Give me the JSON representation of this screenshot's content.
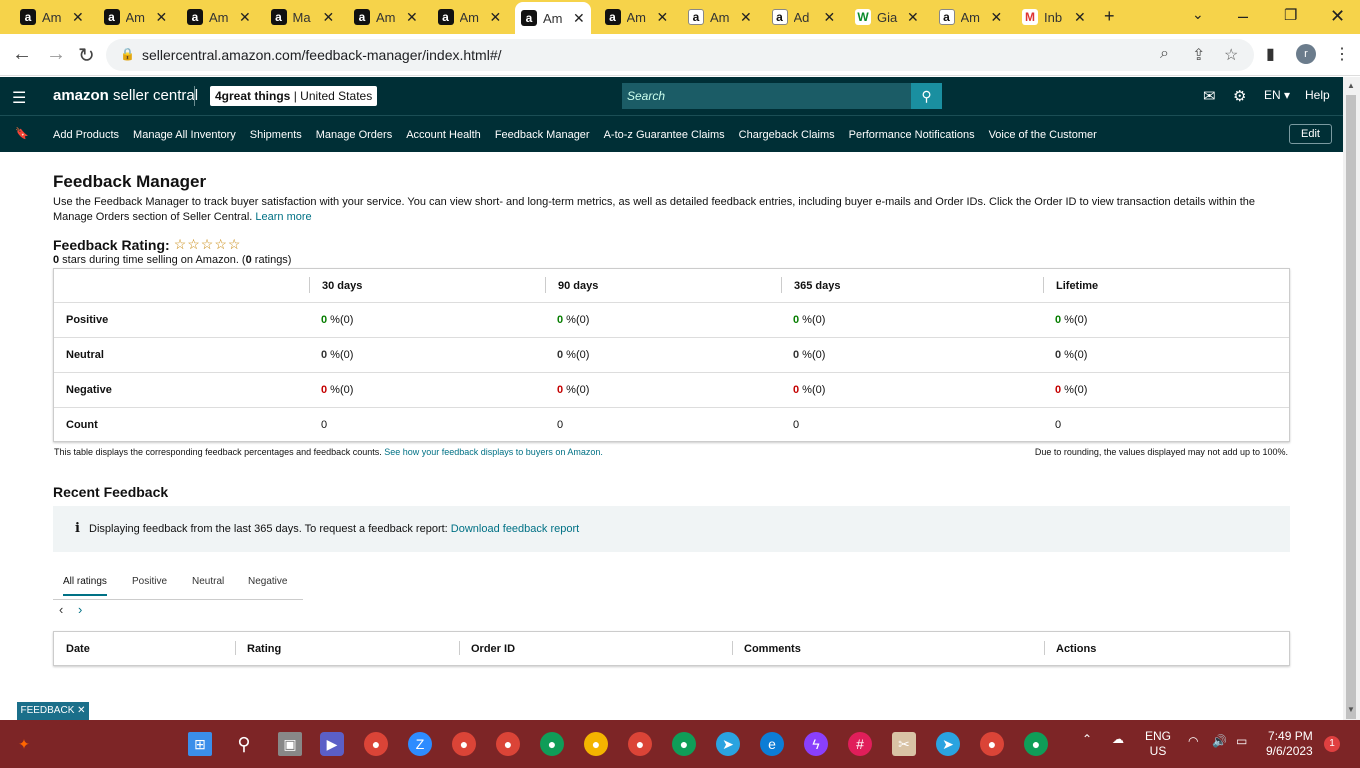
{
  "browser": {
    "tabs": [
      {
        "icon": "amazon-icon",
        "title": "Am",
        "active": false
      },
      {
        "icon": "amazon-icon",
        "title": "Am",
        "active": false
      },
      {
        "icon": "amazon-icon",
        "title": "Am",
        "active": false
      },
      {
        "icon": "amazon-icon",
        "title": "Ma",
        "active": false
      },
      {
        "icon": "amazon-icon",
        "title": "Am",
        "active": false
      },
      {
        "icon": "amazon-icon",
        "title": "Am",
        "active": false
      },
      {
        "icon": "amazon-icon",
        "title": "Am",
        "active": true
      },
      {
        "icon": "amazon-icon",
        "title": "Am",
        "active": false
      },
      {
        "icon": "amazon-icon",
        "title": "Am",
        "active": false
      },
      {
        "icon": "amazon-icon",
        "title": "Ad",
        "active": false
      },
      {
        "icon": "gia-icon",
        "title": "Gia",
        "active": false
      },
      {
        "icon": "amazon-icon",
        "title": "Am",
        "active": false
      },
      {
        "icon": "gmail-icon",
        "title": "Inb",
        "active": false
      }
    ],
    "url": "sellercentral.amazon.com/feedback-manager/index.html#/",
    "profile_initial": "r",
    "tab_strip_color": "#f6d34a"
  },
  "header": {
    "brand_bold": "amazon",
    "brand_rest": " seller central",
    "store_name": "4great things",
    "store_sep": " | ",
    "store_region": "United States",
    "search_placeholder": "Search",
    "lang": "EN",
    "help": "Help",
    "bg_color": "#002f36"
  },
  "nav": {
    "links": [
      "Add Products",
      "Manage All Inventory",
      "Shipments",
      "Manage Orders",
      "Account Health",
      "Feedback Manager",
      "A-to-z Guarantee Claims",
      "Chargeback Claims",
      "Performance Notifications",
      "Voice of the Customer"
    ],
    "edit": "Edit"
  },
  "page": {
    "title": "Feedback Manager",
    "intro": "Use the Feedback Manager to track buyer satisfaction with your service. You can view short- and long-term metrics, as well as detailed feedback entries, including buyer e-mails and Order IDs. Click the Order ID to view transaction details within the Manage Orders section of Seller Central. ",
    "learn_more": "Learn more",
    "rating_label": "Feedback Rating:",
    "stars": "☆☆☆☆☆",
    "summary_stars": "0",
    "summary_mid": " stars during time selling on Amazon. (",
    "summary_count": "0",
    "summary_end": " ratings)"
  },
  "feedback_table": {
    "columns": [
      "30 days",
      "90 days",
      "365 days",
      "Lifetime"
    ],
    "rows": [
      {
        "label": "Positive",
        "values": [
          "0",
          "0",
          "0",
          "0"
        ],
        "suffix": " %(0)",
        "style": "green"
      },
      {
        "label": "Neutral",
        "values": [
          "0",
          "0",
          "0",
          "0"
        ],
        "suffix": " %(0)",
        "style": "muted"
      },
      {
        "label": "Negative",
        "values": [
          "0",
          "0",
          "0",
          "0"
        ],
        "suffix": " %(0)",
        "style": "red"
      },
      {
        "label": "Count",
        "values": [
          "0",
          "0",
          "0",
          "0"
        ],
        "suffix": "",
        "style": "plain"
      }
    ],
    "note_left": "This table displays the corresponding feedback percentages and feedback counts. ",
    "note_link": "See how your feedback displays to buyers on Amazon.",
    "note_right": "Due to rounding, the values displayed may not add up to 100%."
  },
  "recent": {
    "title": "Recent Feedback",
    "info_icon": "i",
    "info_text": "Displaying feedback from the last 365 days. To request a feedback report: ",
    "info_link": "Download feedback report",
    "tabs": [
      "All ratings",
      "Positive",
      "Neutral",
      "Negative"
    ],
    "prev": "‹",
    "next": "›",
    "columns": [
      "Date",
      "Rating",
      "Order ID",
      "Comments",
      "Actions"
    ]
  },
  "feedback_tab": "FEEDBACK ✕",
  "taskbar": {
    "lang_top": "ENG",
    "lang_bottom": "US",
    "time": "7:49 PM",
    "date": "9/6/2023",
    "notif_count": "1",
    "bg_color": "#7d2526"
  }
}
